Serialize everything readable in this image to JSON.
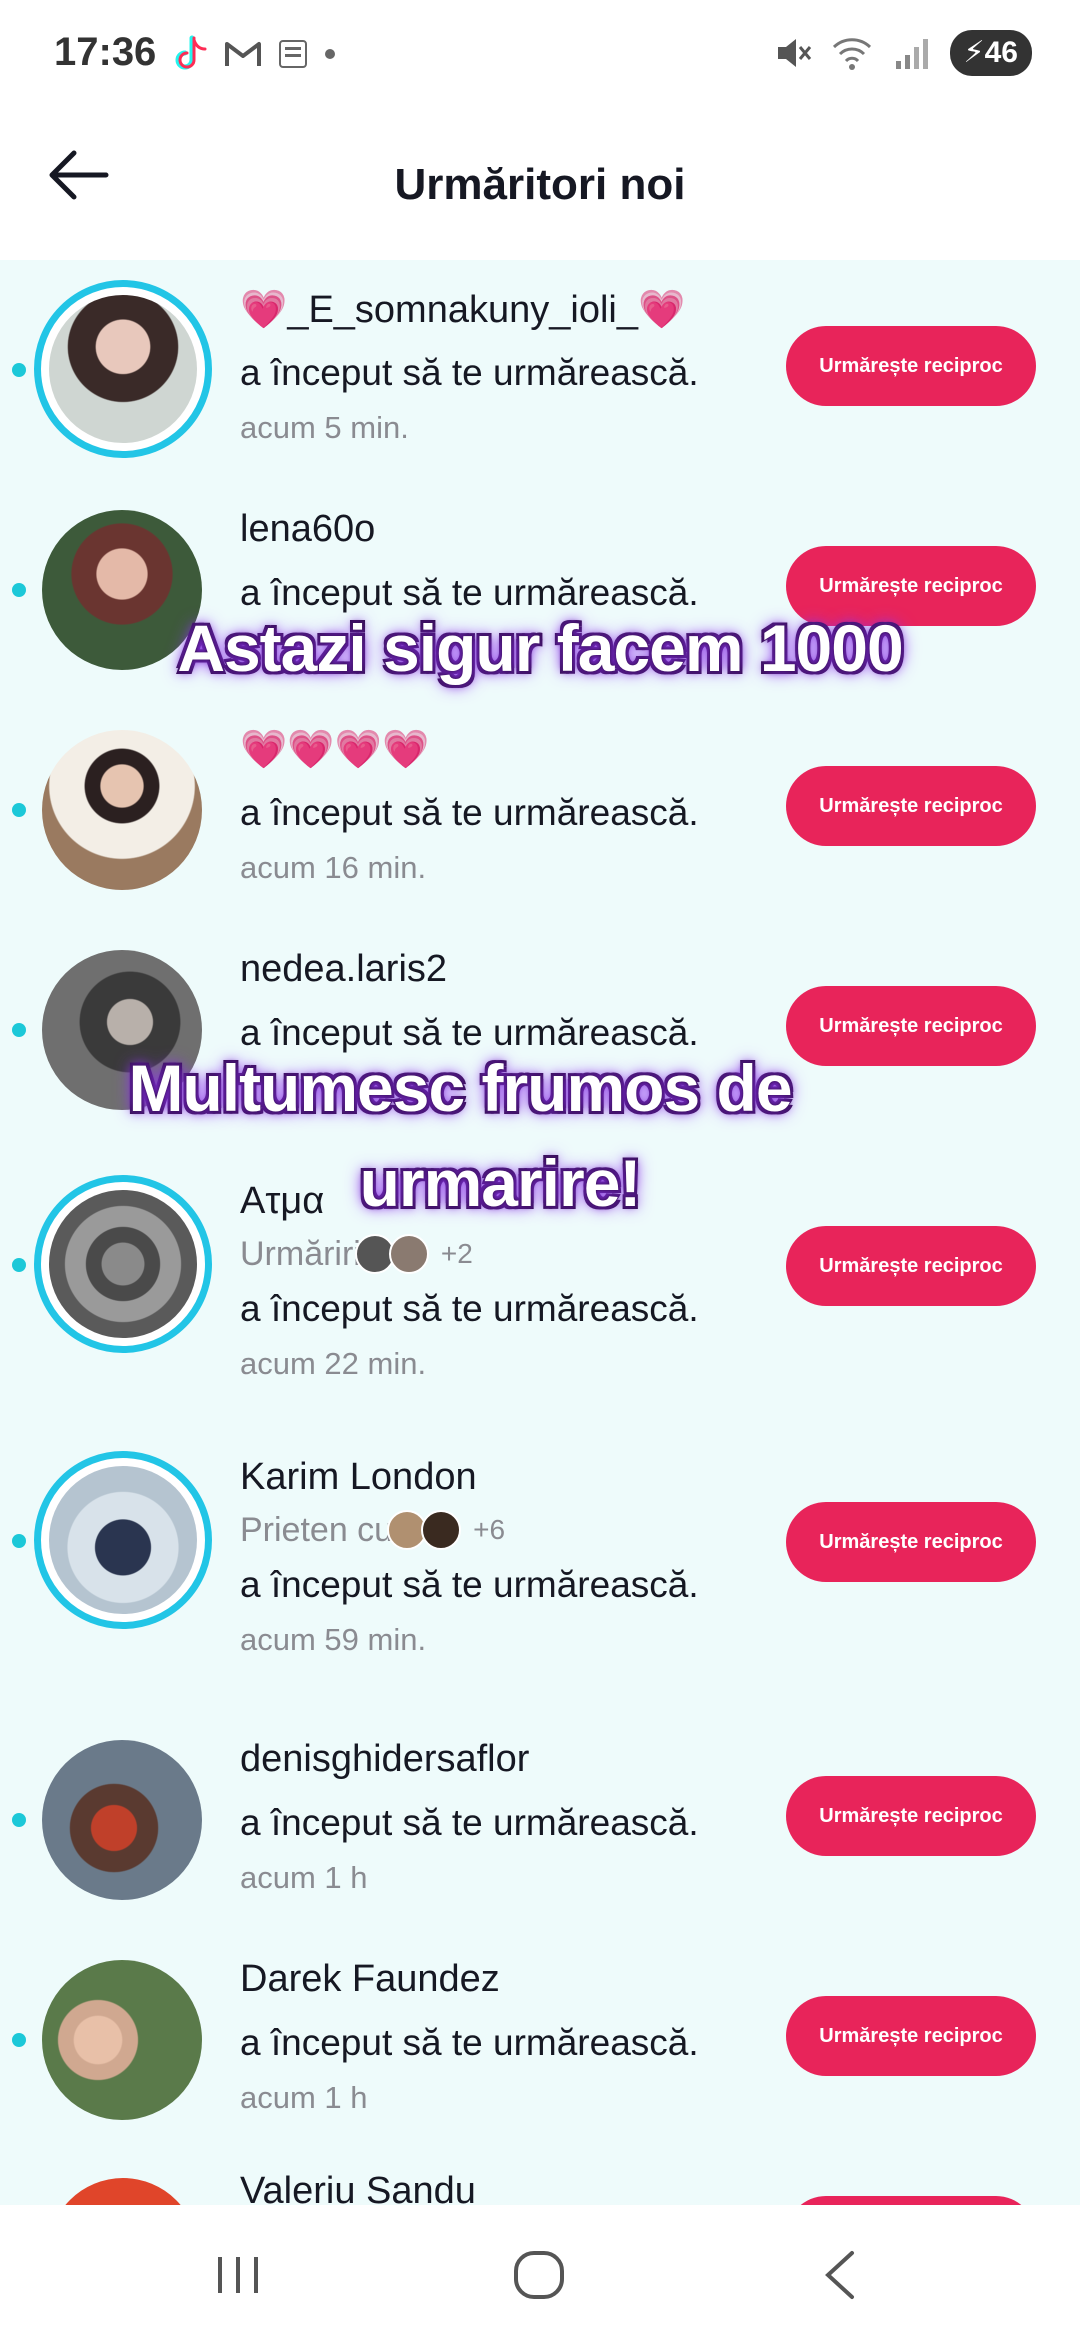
{
  "status_bar": {
    "time": "17:36",
    "app_icons": [
      "tiktok-icon",
      "gmail-icon",
      "prod-hub-icon",
      "dot"
    ],
    "battery": "46",
    "icons": [
      "mute-icon",
      "wifi-icon",
      "signal-icon",
      "battery-charging-icon"
    ]
  },
  "header": {
    "title": "Urmăritori noi",
    "back_icon": "arrow-left-icon"
  },
  "accent_color": "#e8245a",
  "follow_label": "Urmărește reciproc",
  "started_text": "a început să te urmărească.",
  "followers": [
    {
      "name": "💗_E_somnakuny_ioli_💗",
      "time": "acum 5 min."
    },
    {
      "name": "lena60o",
      "time": ""
    },
    {
      "name": "💗💗💗💗",
      "time": "acum 16 min."
    },
    {
      "name": "nedea.laris2",
      "time": ""
    },
    {
      "name": "Ατμα",
      "sub_label": "Urmăriri",
      "sub_extra": "+2",
      "time": "acum 22 min."
    },
    {
      "name": "Karim London",
      "sub_label": "Prieten cu",
      "sub_extra": "+6",
      "time": "acum 59 min."
    },
    {
      "name": "denisghidersaflor",
      "time": "acum 1 h"
    },
    {
      "name": "Darek Faundez",
      "time": "acum 1 h"
    },
    {
      "name": "Valeriu Sandu"
    }
  ],
  "overlay": {
    "caption_1": "Astazi sigur facem 1000",
    "caption_2_line1": "Multumesc frumos de",
    "caption_2_line2": "urmarire!"
  },
  "nav": {
    "recents_icon": "recents-icon",
    "home_icon": "home-icon",
    "back_icon": "back-chevron-icon"
  }
}
